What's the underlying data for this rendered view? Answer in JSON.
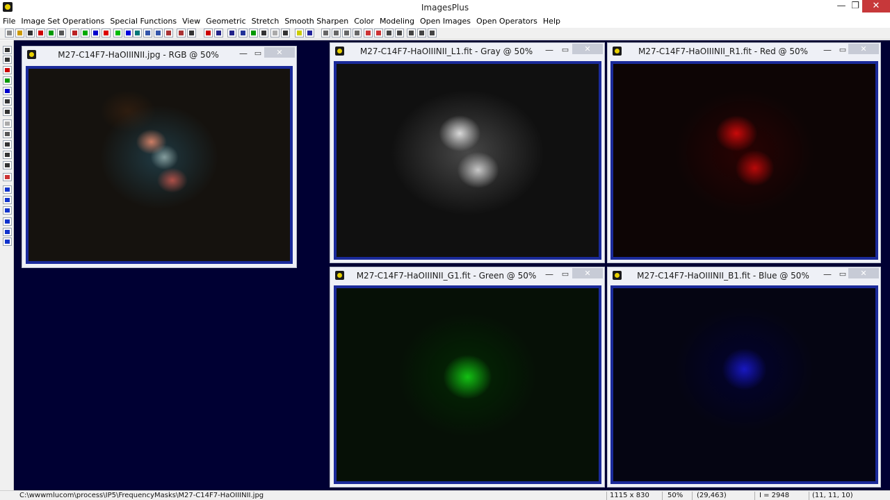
{
  "app": {
    "title": "ImagesPlus"
  },
  "window_controls": {
    "minimize": "—",
    "maximize": "❐",
    "close": "✕"
  },
  "menu": [
    "File",
    "Image Set Operations",
    "Special Functions",
    "View",
    "Geometric",
    "Stretch",
    "Smooth Sharpen",
    "Color",
    "Modeling",
    "Open Images",
    "Open Operators",
    "Help"
  ],
  "image_windows": [
    {
      "title": "M27-C14F7-HaOIIINII.jpg - RGB @ 50%",
      "kind": "rgb"
    },
    {
      "title": "M27-C14F7-HaOIIINII_L1.fit - Gray @ 50%",
      "kind": "gray"
    },
    {
      "title": "M27-C14F7-HaOIIINII_R1.fit - Red @ 50%",
      "kind": "red"
    },
    {
      "title": "M27-C14F7-HaOIIINII_G1.fit - Green @ 50%",
      "kind": "green"
    },
    {
      "title": "M27-C14F7-HaOIIINII_B1.fit - Blue @ 50%",
      "kind": "blue"
    }
  ],
  "subwindow_controls": {
    "minimize": "—",
    "maximize": "▭",
    "close": "✕"
  },
  "status": {
    "path": "C:\\wwwmlucom\\process\\IP5\\FrequencyMasks\\M27-C14F7-HaOIIINII.jpg",
    "dimensions": "1115 x 830",
    "zoom": "50%",
    "coords": "(29,463)",
    "intensity": "I = 2948",
    "rgb": "(11, 11, 10)"
  },
  "colors": {
    "workspace": "#000033",
    "frame": "#1a2a9a",
    "close_red": "#c7383a"
  }
}
